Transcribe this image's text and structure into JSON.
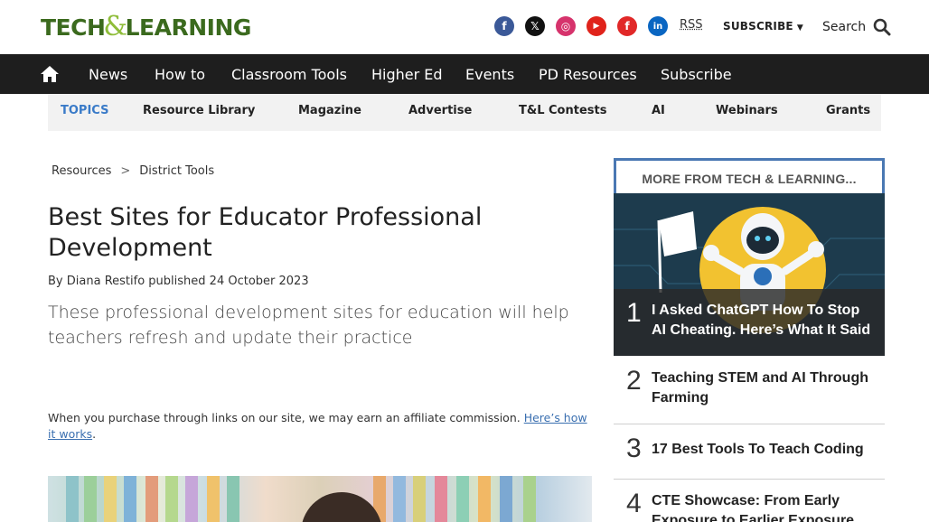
{
  "header": {
    "logo_left": "TECH",
    "logo_amp": "&",
    "logo_right": "LEARNING",
    "rss": "RSS",
    "subscribe": "SUBSCRIBE",
    "search": "Search",
    "socials": [
      {
        "name": "facebook",
        "glyph": "f",
        "color": "#3b5998"
      },
      {
        "name": "x",
        "glyph": "𝕏",
        "color": "#111111"
      },
      {
        "name": "instagram",
        "glyph": "◎",
        "color": "#d6336c"
      },
      {
        "name": "youtube",
        "glyph": "▶",
        "color": "#e0231b"
      },
      {
        "name": "flipboard",
        "glyph": "f",
        "color": "#e12828"
      },
      {
        "name": "linkedin",
        "glyph": "in",
        "color": "#0a66c2"
      }
    ]
  },
  "nav": {
    "items": [
      "News",
      "How to",
      "Classroom Tools",
      "Higher Ed",
      "Events",
      "PD Resources",
      "Subscribe"
    ]
  },
  "topics": {
    "items": [
      "TOPICS",
      "Resource Library",
      "Magazine",
      "Advertise",
      "T&L Contests",
      "AI",
      "Webinars",
      "Grants"
    ]
  },
  "breadcrumb": {
    "items": [
      "Resources",
      "District Tools"
    ],
    "separator": ">"
  },
  "article": {
    "title": "Best Sites for Educator Professional Development",
    "byline_prefix": "By",
    "author": "Diana Restifo",
    "published_label": "published",
    "date": "24 October 2023",
    "strap": "These professional development sites for education will help teachers refresh and update their practice",
    "affiliate_text": "When you purchase through links on our site, we may earn an affiliate commission.",
    "affiliate_link": "Here’s how it works",
    "affiliate_end": "."
  },
  "sidebar": {
    "heading": "MORE FROM TECH & LEARNING...",
    "stories": [
      {
        "rank": "1",
        "title": "I Asked ChatGPT How To Stop AI Cheating. Here’s What It Said"
      },
      {
        "rank": "2",
        "title": "Teaching STEM and AI Through Farming"
      },
      {
        "rank": "3",
        "title": "17 Best Tools To Teach Coding"
      },
      {
        "rank": "4",
        "title": "CTE Showcase: From Early Exposure to Earlier Exposure"
      }
    ]
  },
  "colors": {
    "nav_bg": "#1e1e1e",
    "topics_accent": "#3a7bc8",
    "sidebar_border": "#4a78b3",
    "link": "#3a6fb0"
  }
}
